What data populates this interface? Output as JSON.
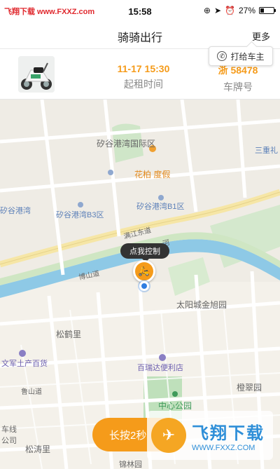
{
  "status_bar": {
    "watermark": "飞翔下载 www.FXXZ.com",
    "time": "15:58",
    "battery": "27%"
  },
  "nav": {
    "title": "骑骑出行",
    "more": "更多"
  },
  "rental_info": {
    "start_time_value": "11-17 15:30",
    "start_time_label": "起租时间",
    "plate_value": "浙 58478",
    "plate_label": "车牌号",
    "call_owner": "打给车主"
  },
  "map": {
    "labels": {
      "area1": "矽谷港湾国际区",
      "hotel": "花柏 度假",
      "sanzhong": "三重礼",
      "guwan": "矽谷港湾",
      "b3": "矽谷港湾B3区",
      "b1": "矽谷港湾B1区",
      "taiyang": "太阳城金旭园",
      "songhe": "松鹤里",
      "wenjun": "文军土产百货",
      "bairuida": "百瑞达便利店",
      "zhongxin": "中心公园",
      "chengcui": "橙翠园",
      "songtao": "松涛里",
      "gongsi": "车线\n公司",
      "jinglin": "锦林园"
    },
    "roads": {
      "manjiang": "满江东道",
      "boshan": "博山道",
      "lushan": "鲁山道",
      "he": "河"
    },
    "tooltip": "点我控制",
    "pin_glyph": "🛵"
  },
  "bottom": {
    "long_press": "长按2秒",
    "watermark_big": "飞翔下载",
    "watermark_small": "WWW.FXXZ.COM"
  }
}
